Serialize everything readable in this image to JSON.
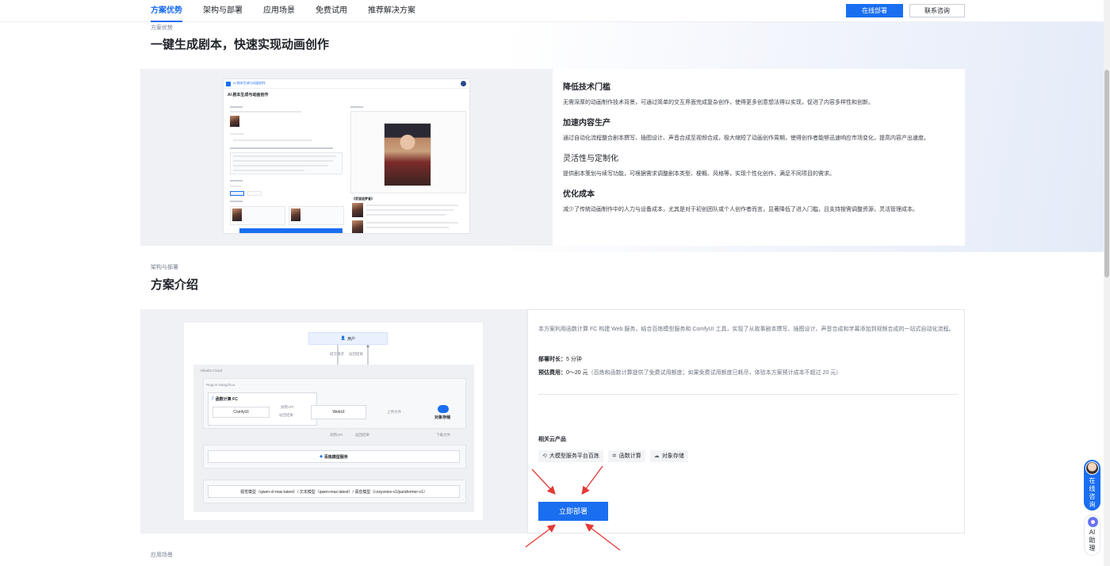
{
  "nav": {
    "tabs": [
      "方案优势",
      "架构与部署",
      "应用场景",
      "免费试用",
      "推荐解决方案"
    ],
    "active_index": 0,
    "deploy_online": "在线部署",
    "contact": "联系咨询"
  },
  "advantages": {
    "eyebrow": "方案优势",
    "title": "一键生成剧本，快速实现动画创作",
    "mockup": {
      "header": "AI 剧本生成与动画创作",
      "subtitle": "AI 剧本生成与动画创作",
      "story_title": "《武道追梦者》"
    },
    "features": [
      {
        "title": "降低技术门槛",
        "desc": "无需深厚的动画制作技术背景，可通过简单的交互界面完成复杂创作，使得更多创意想法得以实现，促进了内容多样性和创新。"
      },
      {
        "title": "加速内容生产",
        "desc": "通过自动化流程整合剧本撰写、插图设计、声音合成至视频合成，极大缩短了动画创作周期，使得创作者能够迅速响应市场变化，提高内容产出速度。"
      },
      {
        "title": "灵活性与定制化",
        "desc": "提供剧本策划与续写功能，可根据需求调整剧本类型、梗概、风格等，实现个性化创作，满足不同项目的需求。"
      },
      {
        "title": "优化成本",
        "desc": "减少了传统动画制作中的人力与设备成本，尤其是对于初创团队或个人创作者而言，显著降低了进入门槛，且支持按需调整资源，灵活管理成本。"
      }
    ]
  },
  "intro": {
    "eyebrow": "架构与部署",
    "title": "方案介绍",
    "description": "本方案利用函数计算 FC 构建 Web 服务，结合百炼模型服务和 ComfyUI 工具，实现了从故事剧本撰写、插图设计、声音合成和字幕添加到视频合成的一站式自动化流程。",
    "deploy_time_label": "部署时长：",
    "deploy_time_value": "5 分钟",
    "cost_label": "预估费用：",
    "cost_value": "0～20 元",
    "cost_note": "（百炼和函数计算提供了免费试用额度；如果免费试用额度已耗尽，体验本方案预计成本不超过 20 元）",
    "related_title": "相关云产品",
    "products": [
      {
        "icon": "bailian-icon",
        "label": "大模型服务平台百炼"
      },
      {
        "icon": "function-compute-icon",
        "label": "函数计算"
      },
      {
        "icon": "oss-icon",
        "label": "对象存储"
      }
    ],
    "deploy_button": "立即部署",
    "diagram": {
      "user": "用户",
      "submit": "提交请求",
      "return": "返回结果",
      "cloud": "Alibaba Cloud",
      "region": "Region-Hangzhou",
      "fc": "函数计算 FC",
      "comfyui": "ComfyUI",
      "call_api": "调用API",
      "return_result": "返回结果",
      "webui": "WebUI",
      "upload": "上传文件",
      "oss": "对象存储",
      "call_api2": "调用API",
      "return_result2": "返回结果",
      "download": "下载文件",
      "bailian": "百炼模型服务",
      "models": "视觉模型（qwen-vl-max-latest）/ 文本模型（qwen-max-latest）/ 语音模型（cosyvoice-v1/paraformer-v1）"
    }
  },
  "next_section": {
    "eyebrow": "应用场景"
  },
  "floating": {
    "consult": "在线咨询",
    "ai": "AI助理"
  },
  "colors": {
    "primary": "#1a6ef0",
    "arrow": "#e53935"
  }
}
